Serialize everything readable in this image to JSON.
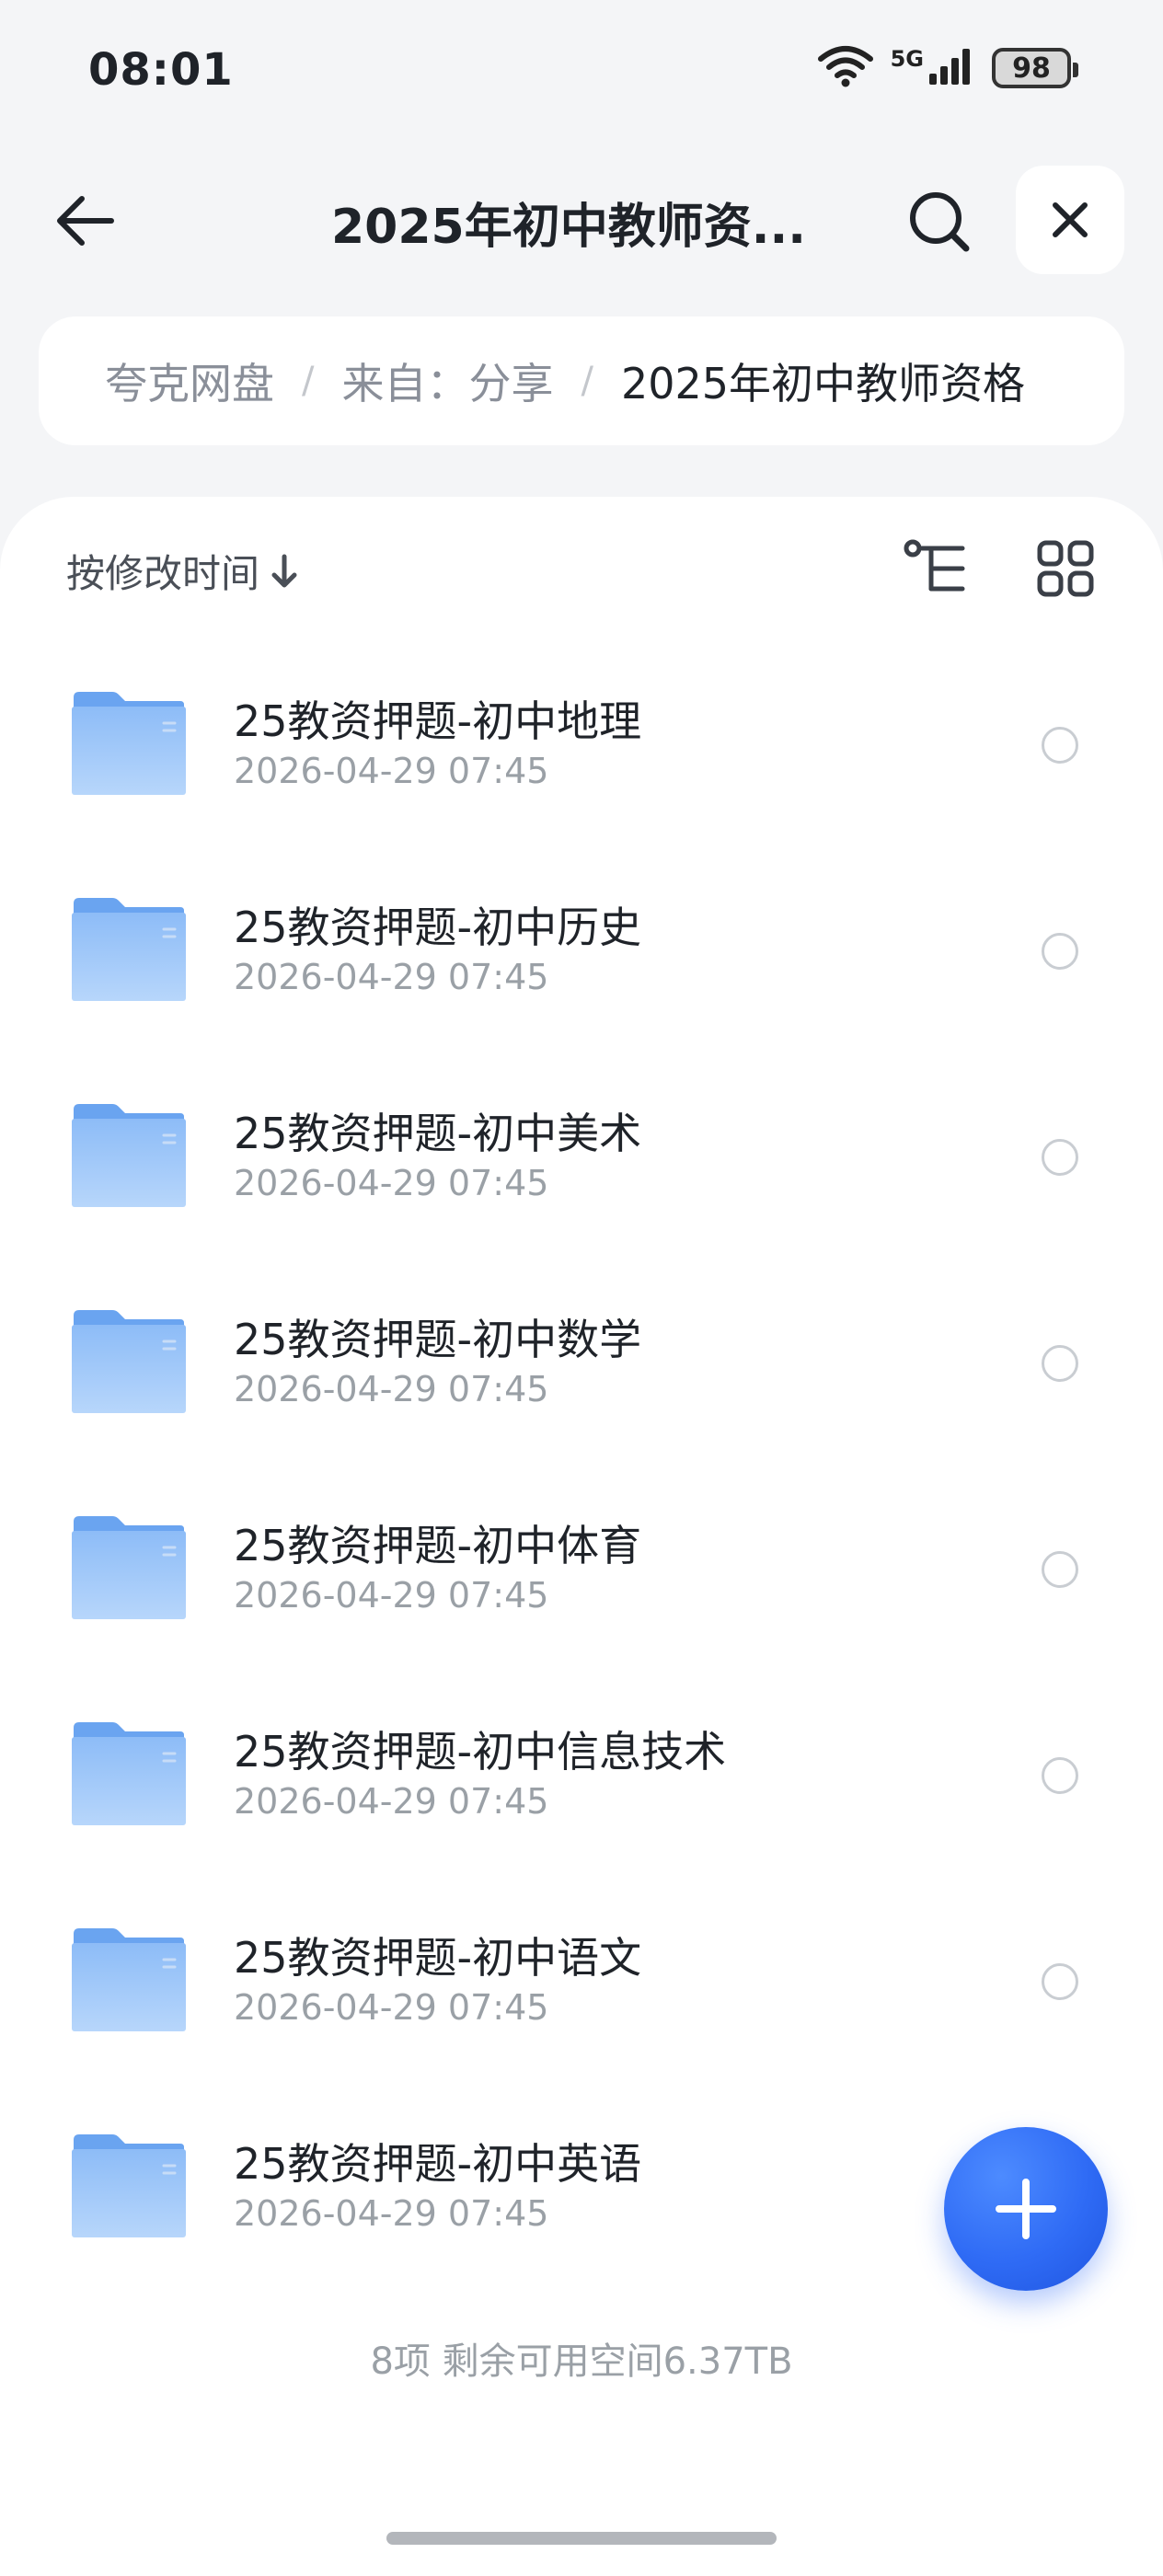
{
  "status_bar": {
    "time": "08:01",
    "network": "5G",
    "battery": "98",
    "icons": [
      "wifi-icon",
      "signal-icon",
      "battery-icon"
    ]
  },
  "nav": {
    "title": "2025年初中教师资...",
    "icons": [
      "back-arrow-icon",
      "search-icon",
      "close-icon"
    ]
  },
  "breadcrumb": {
    "items": [
      "夸克网盘",
      "来自：分享",
      "2025年初中教师资格"
    ],
    "separator": "/"
  },
  "toolbar": {
    "sort_label": "按修改时间",
    "icons": [
      "sort-down-arrow-icon",
      "tree-view-icon",
      "grid-view-icon"
    ]
  },
  "files": [
    {
      "name": "25教资押题-初中地理",
      "date": "2026-04-29 07:45"
    },
    {
      "name": "25教资押题-初中历史",
      "date": "2026-04-29 07:45"
    },
    {
      "name": "25教资押题-初中美术",
      "date": "2026-04-29 07:45"
    },
    {
      "name": "25教资押题-初中数学",
      "date": "2026-04-29 07:45"
    },
    {
      "name": "25教资押题-初中体育",
      "date": "2026-04-29 07:45"
    },
    {
      "name": "25教资押题-初中信息技术",
      "date": "2026-04-29 07:45"
    },
    {
      "name": "25教资押题-初中语文",
      "date": "2026-04-29 07:45"
    },
    {
      "name": "25教资押题-初中英语",
      "date": "2026-04-29 07:45"
    }
  ],
  "footer": {
    "summary": "8项 剩余可用空间6.37TB"
  },
  "fab": {
    "icon": "plus-icon"
  },
  "colors": {
    "accent": "#2f6bf5",
    "folder": "#7fb2f5",
    "background": "#f4f5f7",
    "text_primary": "#1f2329",
    "text_secondary": "#9aa0a6"
  }
}
